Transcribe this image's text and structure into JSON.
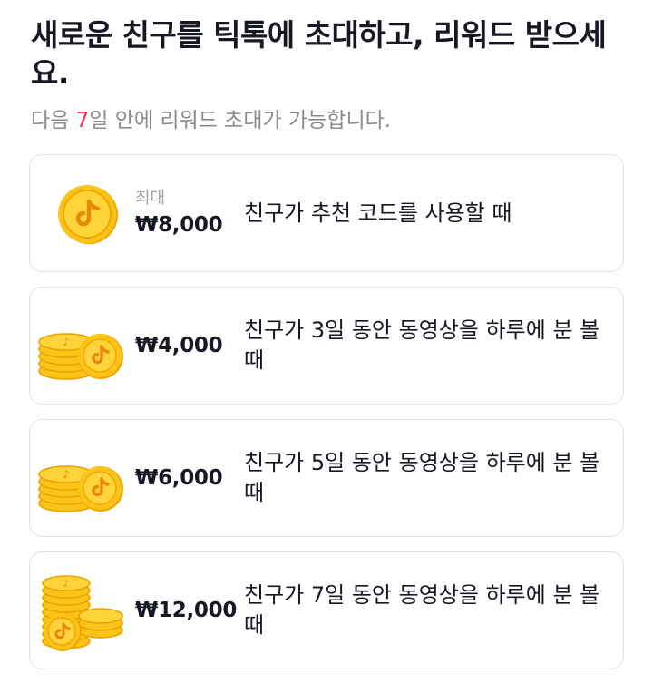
{
  "header": {
    "title": "새로운 친구를 틱톡에 초대하고, 리워드 받으세요.",
    "subtitle_prefix": "다음 ",
    "subtitle_days": "7",
    "subtitle_suffix": "일 안에 리워드 초대가 가능합니다."
  },
  "colors": {
    "accent": "#fe2c55",
    "coin_gold": "#f5b800",
    "text_primary": "#161823",
    "text_secondary": "#8a8b91"
  },
  "rewards": [
    {
      "icon": "single-coin-icon",
      "caption": "최대",
      "amount": "₩8,000",
      "description": "친구가 추천 코드를 사용할 때"
    },
    {
      "icon": "coin-stack-icon",
      "caption": "",
      "amount": "₩4,000",
      "description": "친구가 3일 동안 동영상을 하루에 분 볼 때"
    },
    {
      "icon": "coin-stack-icon",
      "caption": "",
      "amount": "₩6,000",
      "description": "친구가 5일 동안 동영상을 하루에 분 볼 때"
    },
    {
      "icon": "coin-pile-icon",
      "caption": "",
      "amount": "₩12,000",
      "description": "친구가 7일 동안 동영상을 하루에 분 볼 때"
    }
  ]
}
